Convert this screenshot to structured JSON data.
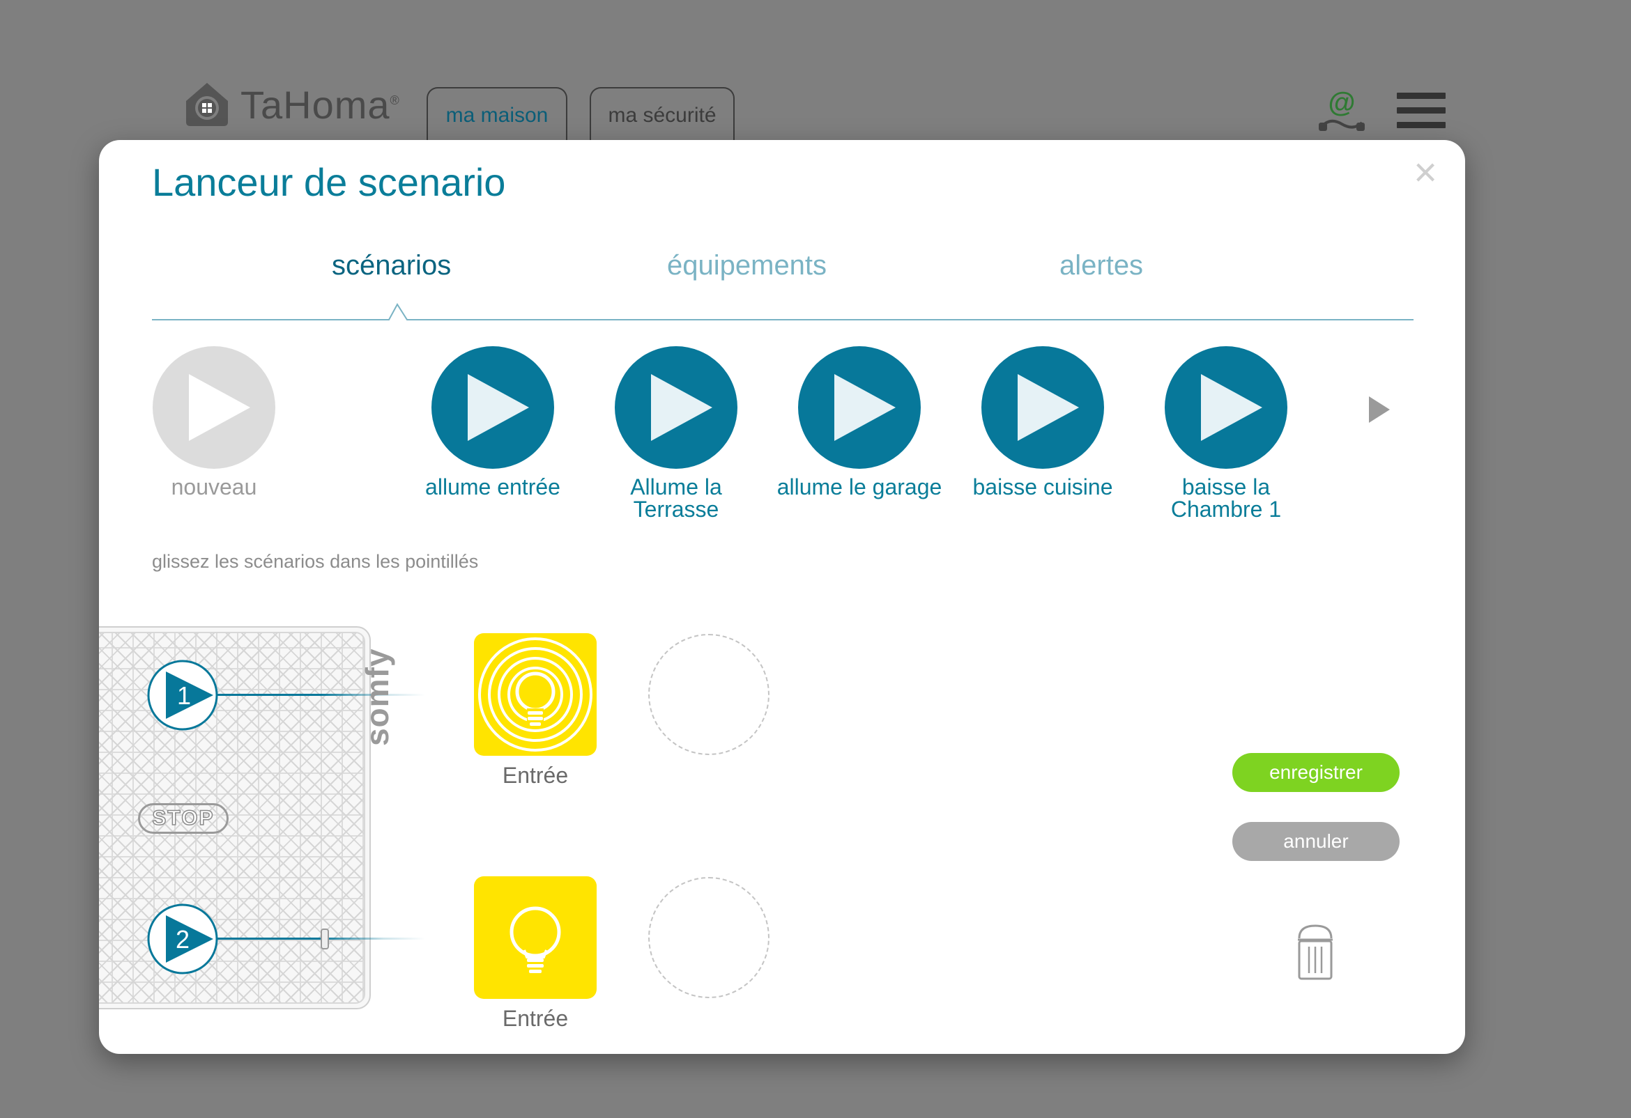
{
  "header": {
    "brand": "TaHoma",
    "brand_reg": "®",
    "tabs": [
      {
        "label": "ma maison"
      },
      {
        "label": "ma sécurité"
      }
    ],
    "icons": [
      "house-logo-icon",
      "at-connection-icon",
      "hamburger-menu-icon"
    ]
  },
  "modal": {
    "title": "Lanceur de scenario",
    "close_label": "×",
    "tabs": [
      {
        "label": "scénarios",
        "active": true
      },
      {
        "label": "équipements",
        "active": false
      },
      {
        "label": "alertes",
        "active": false
      }
    ],
    "scenarios": [
      {
        "label": "nouveau",
        "state": "new"
      },
      {
        "label": "allume entrée",
        "state": "active"
      },
      {
        "label": "Allume la Terrasse",
        "state": "active"
      },
      {
        "label": "allume le garage",
        "state": "active"
      },
      {
        "label": "baisse cuisine",
        "state": "active"
      },
      {
        "label": "baisse la Chambre 1",
        "state": "active"
      }
    ],
    "hint": "glissez les scénarios dans les pointillés",
    "remote": {
      "button1": "1",
      "button2": "2",
      "stop": "STOP",
      "brand": "somfy"
    },
    "assigned": [
      {
        "label": "Entrée",
        "icon": "light-bulb-glowing-icon"
      },
      {
        "label": "Entrée",
        "icon": "light-bulb-icon"
      }
    ],
    "buttons": {
      "save": "enregistrer",
      "cancel": "annuler"
    },
    "colors": {
      "accent": "#0a7d99",
      "scenario": "#07789a",
      "save": "#7ed321",
      "cancel": "#a8a8a8",
      "device": "#ffe400"
    }
  }
}
